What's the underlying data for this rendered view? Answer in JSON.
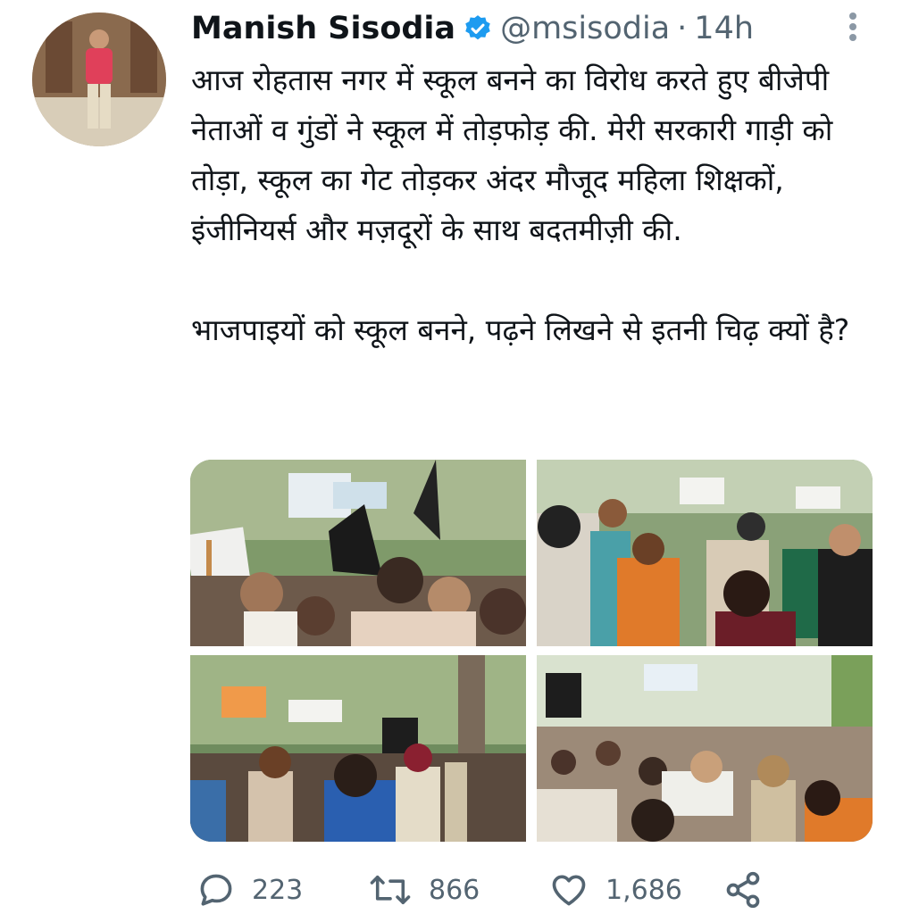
{
  "tweet": {
    "author_name": "Manish Sisodia",
    "handle": "@msisodia",
    "separator": "·",
    "time": "14h",
    "paragraphs": [
      "आज रोहतास नगर में स्कूल बनने का विरोध करते हुए बीजेपी नेताओं व गुंडों ने स्कूल में तोड़फोड़ की. मेरी सरकारी गाड़ी को तोड़ा, स्कूल का गेट तोड़कर अंदर मौजूद महिला शिक्षकों, इंजीनियर्स और मज़दूरों के साथ बदतमीज़ी की.",
      "भाजपाइयों को स्कूल बनने, पढ़ने लिखने से इतनी चिढ़ क्यों है?"
    ],
    "media": [
      "photo-1",
      "photo-2",
      "photo-3",
      "photo-4"
    ],
    "actions": {
      "replies": "223",
      "retweets": "866",
      "likes": "1,686"
    },
    "icons": {
      "verified": "verified-badge-icon",
      "more": "more-options-icon",
      "reply": "reply-icon",
      "retweet": "retweet-icon",
      "like": "heart-icon",
      "share": "share-icon"
    },
    "colors": {
      "verified_blue": "#1d9bf0",
      "secondary_text": "#536471",
      "primary_text": "#0f1419"
    }
  }
}
